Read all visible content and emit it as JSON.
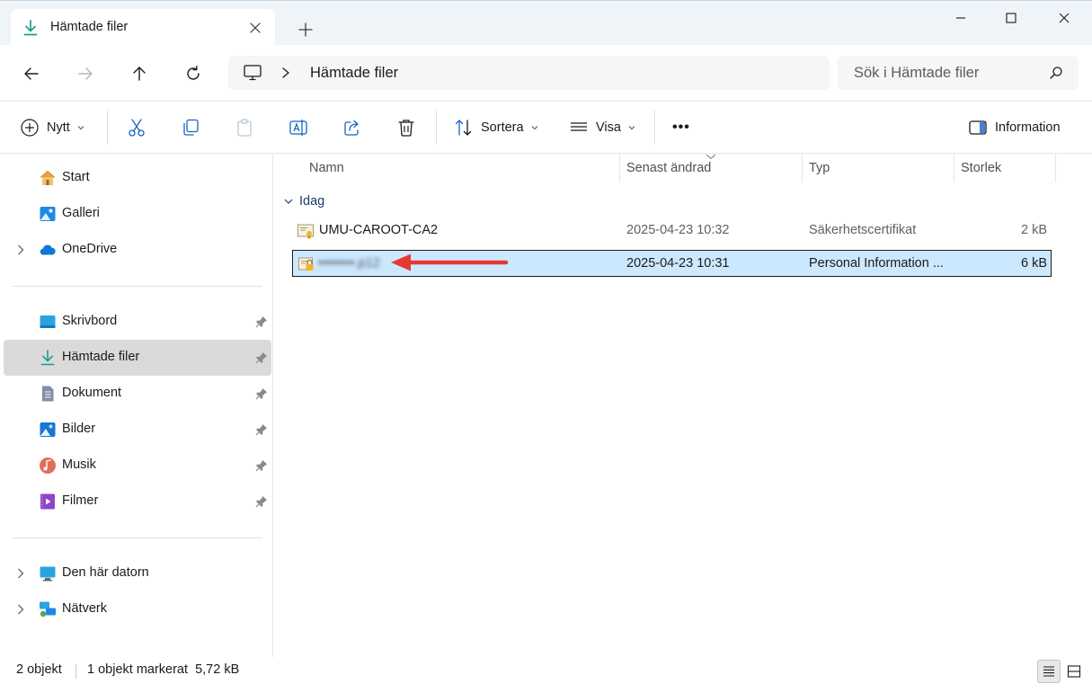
{
  "window": {
    "tab_title": "Hämtade filer",
    "tab_icon": "download-arrow-icon",
    "controls": [
      "minimize-icon",
      "maximize-icon",
      "close-icon"
    ]
  },
  "address": {
    "location_icon": "this-pc-icon",
    "path": "Hämtade filer",
    "search_placeholder": "Sök i Hämtade filer"
  },
  "toolbar": {
    "new_label": "Nytt",
    "sort_label": "Sortera",
    "view_label": "Visa",
    "more_label": "•••",
    "details_label": "Information",
    "icons": [
      "cut-icon",
      "copy-icon",
      "paste-icon",
      "rename-icon",
      "share-icon",
      "delete-icon"
    ]
  },
  "sidebar": {
    "items": [
      {
        "label": "Start",
        "icon": "home-icon",
        "pinned": false
      },
      {
        "label": "Galleri",
        "icon": "gallery-icon",
        "pinned": false
      },
      {
        "label": "OneDrive",
        "icon": "onedrive-cloud-icon",
        "pinned": false,
        "expandable": true
      },
      {
        "label": "Skrivbord",
        "icon": "desktop-icon",
        "pinned": true
      },
      {
        "label": "Hämtade filer",
        "icon": "download-icon",
        "pinned": true,
        "selected": true
      },
      {
        "label": "Dokument",
        "icon": "document-icon",
        "pinned": true
      },
      {
        "label": "Bilder",
        "icon": "pictures-icon",
        "pinned": true
      },
      {
        "label": "Musik",
        "icon": "music-icon",
        "pinned": true
      },
      {
        "label": "Filmer",
        "icon": "videos-icon",
        "pinned": true
      },
      {
        "label": "Den här datorn",
        "icon": "this-pc-icon",
        "pinned": false,
        "expandable": true
      },
      {
        "label": "Nätverk",
        "icon": "network-icon",
        "pinned": false,
        "expandable": true
      }
    ]
  },
  "files": {
    "columns": [
      "Namn",
      "Senast ändrad",
      "Typ",
      "Storlek"
    ],
    "group": "Idag",
    "rows": [
      {
        "name": "UMU-CAROOT-CA2",
        "modified": "2025-04-23 10:32",
        "type": "Säkerhetscertifikat",
        "size": "2 kB",
        "icon": "certificate-icon",
        "selected": false
      },
      {
        "name": "••••••••.p12",
        "modified": "2025-04-23 10:31",
        "type": "Personal Information ...",
        "size": "6 kB",
        "icon": "pfx-certificate-icon",
        "selected": true,
        "name_obscured": true
      }
    ],
    "annotation": "red-arrow-pointing-left"
  },
  "status": {
    "count": "2 objekt",
    "selection": "1 objekt markerat  5,72 kB",
    "view_buttons": [
      "details-view-icon",
      "tiles-view-icon"
    ]
  },
  "colors": {
    "titlebar": "#eff4f9",
    "selection": "#cce8ff",
    "sidebar_selected": "#dadada",
    "accent": "#0067c0",
    "annotation": "#e53935"
  }
}
